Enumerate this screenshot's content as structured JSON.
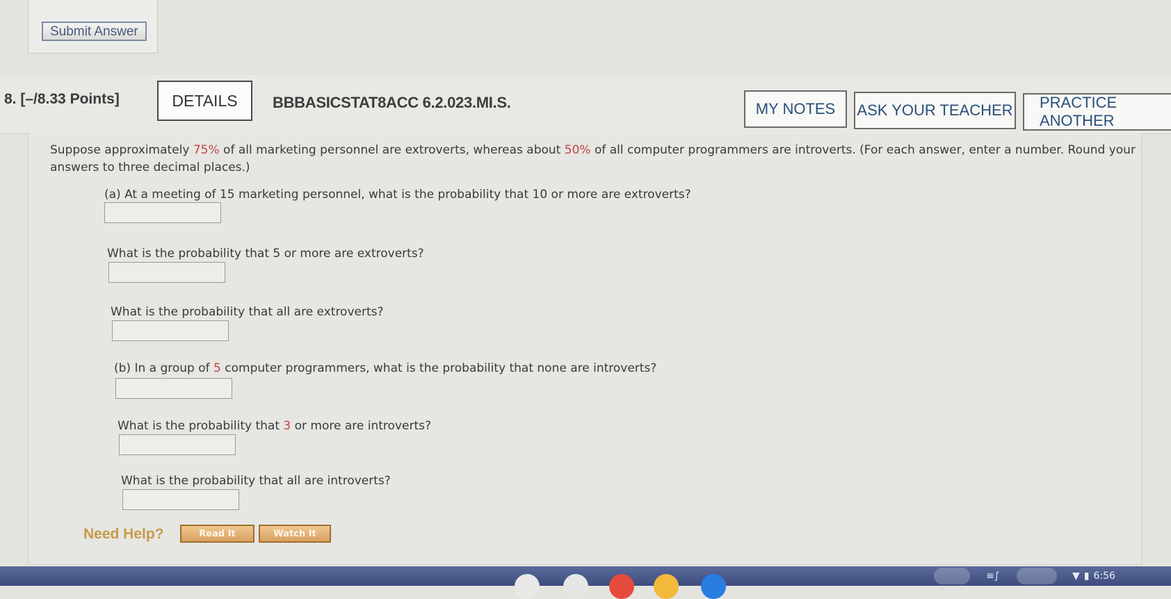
{
  "prev": {
    "submit_label": "Submit Answer"
  },
  "header": {
    "question_number": "8.",
    "points": "[–/8.33 Points]",
    "details_label": "DETAILS",
    "problem_code": "BBBASICSTAT8ACC 6.2.023.MI.S.",
    "my_notes_label": "MY NOTES",
    "ask_teacher_label": "ASK YOUR TEACHER",
    "practice_another_label": "PRACTICE ANOTHER"
  },
  "intro": {
    "part1": "Suppose approximately ",
    "pct_extroverts": "75%",
    "part2": " of all marketing personnel are extroverts, whereas about ",
    "pct_introverts": "50%",
    "part3": " of all computer programmers are introverts. (For each answer, enter a number. Round your answers to three decimal places.)"
  },
  "questions": {
    "a_prefix": "(a) At a meeting of 15 marketing personnel, what is the probability that 10 or more are extroverts?",
    "a2": "What is the probability that 5 or more are extroverts?",
    "a3": "What is the probability that all are extroverts?",
    "b_prefix": "(b) In a group of ",
    "b_n": "5",
    "b_suffix": " computer programmers, what is the probability that none are introverts?",
    "b2_prefix": "What is the probability that ",
    "b2_n": "3",
    "b2_suffix": " or more are introverts?",
    "b3": "What is the probability that all are introverts?"
  },
  "answers": {
    "a1": "",
    "a2": "",
    "a3": "",
    "b1": "",
    "b2": "",
    "b3": ""
  },
  "help": {
    "label": "Need Help?",
    "read_label": "Read It",
    "watch_label": "Watch It"
  },
  "taskbar": {
    "time": "6:56"
  },
  "colors": {
    "highlight": "#c24545",
    "link": "#2a4f7a",
    "help": "#c89a4a",
    "taskbar": "#4a5a8c"
  }
}
